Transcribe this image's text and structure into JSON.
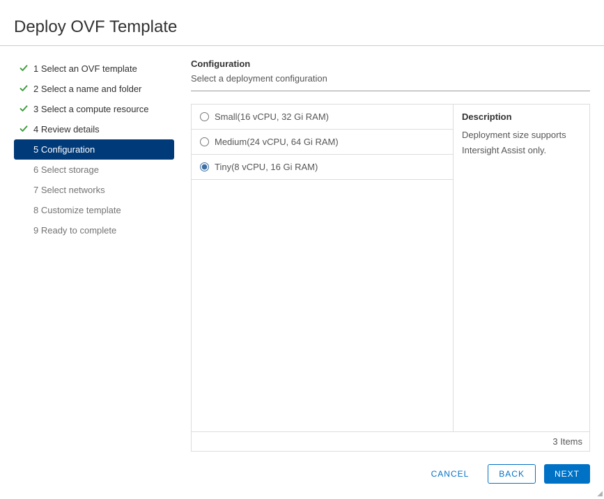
{
  "dialog": {
    "title": "Deploy OVF Template"
  },
  "steps": [
    {
      "label": "1 Select an OVF template",
      "status": "completed"
    },
    {
      "label": "2 Select a name and folder",
      "status": "completed"
    },
    {
      "label": "3 Select a compute resource",
      "status": "completed"
    },
    {
      "label": "4 Review details",
      "status": "completed"
    },
    {
      "label": "5 Configuration",
      "status": "active"
    },
    {
      "label": "6 Select storage",
      "status": "pending"
    },
    {
      "label": "7 Select networks",
      "status": "pending"
    },
    {
      "label": "8 Customize template",
      "status": "pending"
    },
    {
      "label": "9 Ready to complete",
      "status": "pending"
    }
  ],
  "panel": {
    "heading": "Configuration",
    "subtitle": "Select a deployment configuration"
  },
  "options": [
    {
      "label": "Small(16 vCPU, 32 Gi RAM)",
      "selected": false
    },
    {
      "label": "Medium(24 vCPU, 64 Gi RAM)",
      "selected": false
    },
    {
      "label": "Tiny(8 vCPU, 16 Gi RAM)",
      "selected": true
    }
  ],
  "description": {
    "heading": "Description",
    "text": "Deployment size supports Intersight Assist only."
  },
  "footer": {
    "item_count": "3 Items"
  },
  "buttons": {
    "cancel": "CANCEL",
    "back": "BACK",
    "next": "NEXT"
  }
}
